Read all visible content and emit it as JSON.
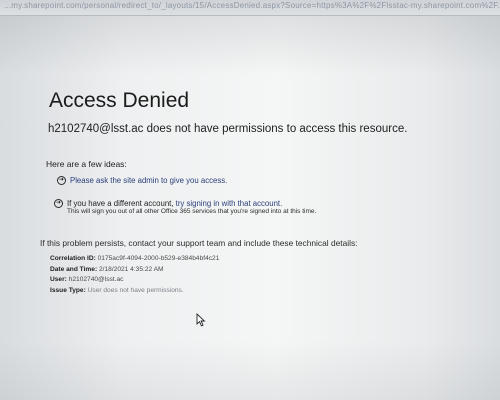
{
  "browser": {
    "url": "...my.sharepoint.com/personal/redirect_to/_layouts/15/AccessDenied.aspx?Source=https%3A%2F%2Flsstac-my.sharepoint.com%2F..."
  },
  "page": {
    "title": "Access Denied",
    "subtitle": "h2102740@lsst.ac does not have permissions to access this resource."
  },
  "ideas": {
    "heading": "Here are a few ideas:",
    "items": [
      {
        "text": "Please ask the site admin to give you access.",
        "icon": "arrow-circle-icon"
      },
      {
        "text_prefix": "If you have a different account, ",
        "link": "try signing in with that account.",
        "icon": "arrow-circle-icon"
      }
    ],
    "note": "This will sign you out of all other Office 365 services that you're signed into at this time."
  },
  "support": {
    "message": "If this problem persists, contact your support team and include these technical details:",
    "details": [
      {
        "label": "Correlation ID:",
        "value": "0175ac9f-4094-2000-b529-e384b4bf4c21"
      },
      {
        "label": "Date and Time:",
        "value": "2/18/2021 4:35:22 AM"
      },
      {
        "label": "User:",
        "value": "h2102740@lsst.ac"
      },
      {
        "label": "Issue Type:",
        "value": "User does not have permissions."
      }
    ]
  },
  "colors": {
    "background": "#eef0f1",
    "link": "#2b3f7a",
    "text": "#1b1b1b",
    "muted": "#7b7f85"
  }
}
